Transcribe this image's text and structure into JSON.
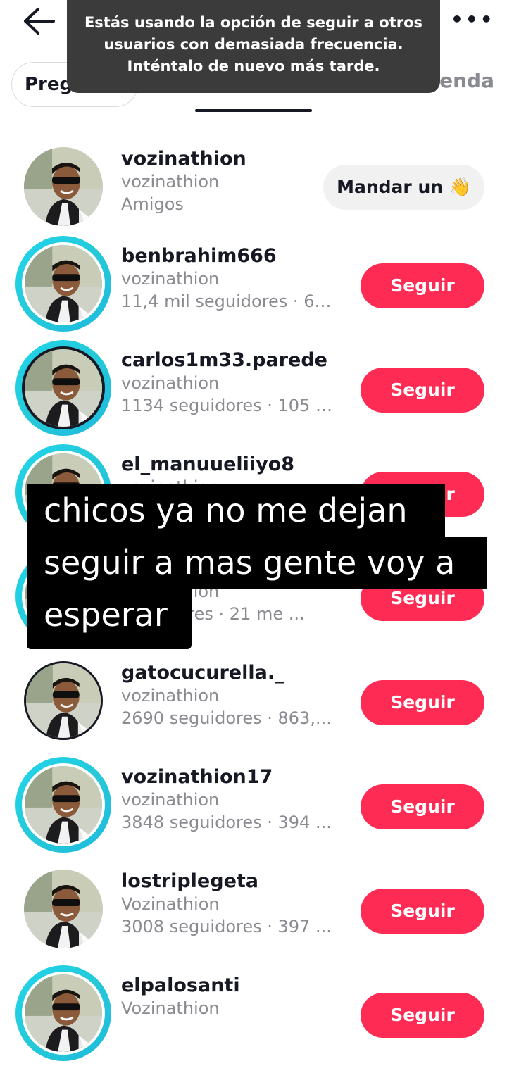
{
  "toast": {
    "lines": [
      "Estás usando la opción de seguir a otros",
      "usuarios con demasiada frecuencia.",
      "Inténtalo de nuevo más tarde."
    ]
  },
  "tabs": {
    "left_chip": "Pregu",
    "right_tab": "ienda"
  },
  "users": [
    {
      "username": "vozinathion",
      "nickname": "vozinathion",
      "detail": "Amigos",
      "action": "Mandar un 👋"
    },
    {
      "username": "benbrahim666",
      "nickname": "vozinathion",
      "detail": "11,4 mil seguidores · 66...",
      "action": "Seguir"
    },
    {
      "username": "carlos1m33.parede",
      "nickname": "vozinathion",
      "detail": "1134 seguidores · 105 m...",
      "action": "Seguir"
    },
    {
      "username": "el_manuueliiyo8",
      "nickname": "vozinathion",
      "detail": "",
      "action": "Seguir"
    },
    {
      "username": "",
      "nickname": "vozinathion",
      "detail": "seguidores · 21 me ...",
      "action": "Seguir"
    },
    {
      "username": "gatocucurella._",
      "nickname": "vozinathion",
      "detail": "2690 seguidores · 863,...",
      "action": "Seguir"
    },
    {
      "username": "vozinathion17",
      "nickname": "vozinathion",
      "detail": "3848 seguidores · 394 ...",
      "action": "Seguir"
    },
    {
      "username": "lostriplegeta",
      "nickname": "Vozinathion",
      "detail": "3008 seguidores · 397 ...",
      "action": "Seguir"
    },
    {
      "username": "elpalosanti",
      "nickname": "Vozinathion",
      "detail": "",
      "action": "Seguir"
    }
  ],
  "caption": {
    "lines": [
      "chicos ya no me dejan",
      "seguir a mas gente voy a",
      "esperar"
    ]
  },
  "icons": {
    "back": "arrow-left-icon",
    "more": "more-horizontal-icon"
  },
  "colors": {
    "accent": "#fe2c55",
    "ring": "#20d5ec",
    "toast_bg": "#3b3b3b"
  }
}
